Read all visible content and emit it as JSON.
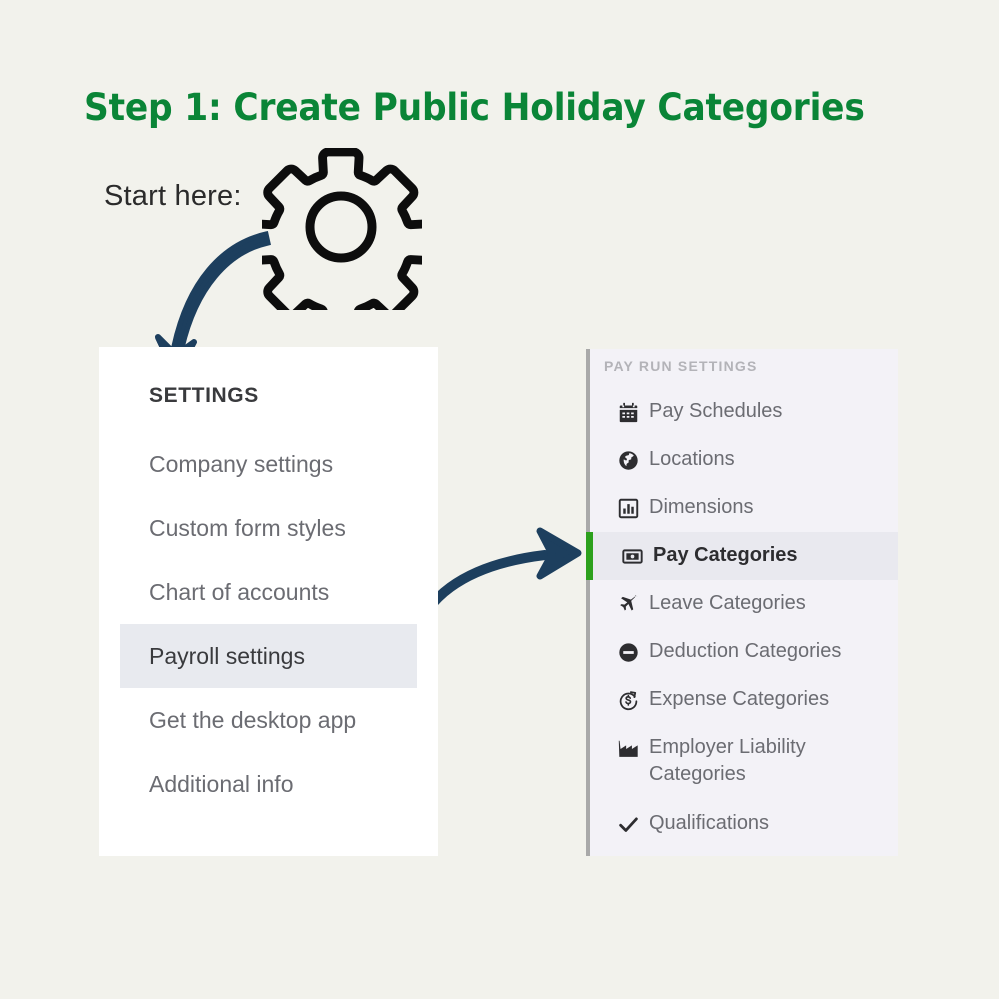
{
  "page": {
    "background_color": "#f2f2ec",
    "title": "Step 1: Create Public Holiday Categories",
    "title_color": "#0a8537",
    "annotation_color": "#1d3f5e",
    "accent_green": "#2ca01c"
  },
  "annotation": {
    "start_here_label": "Start here:",
    "gear_icon": "gear-icon",
    "arrow_one": "curved-arrow-down",
    "arrow_two": "curved-arrow-right"
  },
  "settings_panel": {
    "heading": "SETTINGS",
    "background_color": "#ffffff",
    "selected_item": "Payroll settings",
    "selected_background": "#e8eaef",
    "items": [
      {
        "label": "Company settings",
        "selected": false
      },
      {
        "label": "Custom form styles",
        "selected": false
      },
      {
        "label": "Chart of accounts",
        "selected": false
      },
      {
        "label": "Payroll settings",
        "selected": true
      },
      {
        "label": "Get the desktop app",
        "selected": false
      },
      {
        "label": "Additional info",
        "selected": false
      }
    ]
  },
  "payrun_panel": {
    "header": "PAY RUN SETTINGS",
    "background_color": "#f3f2f7",
    "selected_item": "Pay Categories",
    "selected_background": "#e9e9ef",
    "selected_bar_color": "#2ca01c",
    "items": [
      {
        "label": "Pay Schedules",
        "icon": "calendar-icon",
        "selected": false
      },
      {
        "label": "Locations",
        "icon": "globe-icon",
        "selected": false
      },
      {
        "label": "Dimensions",
        "icon": "bar-chart-icon",
        "selected": false
      },
      {
        "label": "Pay Categories",
        "icon": "money-bill-icon",
        "selected": true
      },
      {
        "label": "Leave Categories",
        "icon": "plane-icon",
        "selected": false
      },
      {
        "label": "Deduction Categories",
        "icon": "minus-circle-icon",
        "selected": false
      },
      {
        "label": "Expense Categories",
        "icon": "dollar-refresh-icon",
        "selected": false
      },
      {
        "label": "Employer Liability Categories",
        "icon": "factory-icon",
        "selected": false
      },
      {
        "label": "Qualifications",
        "icon": "check-icon",
        "selected": false
      }
    ]
  }
}
